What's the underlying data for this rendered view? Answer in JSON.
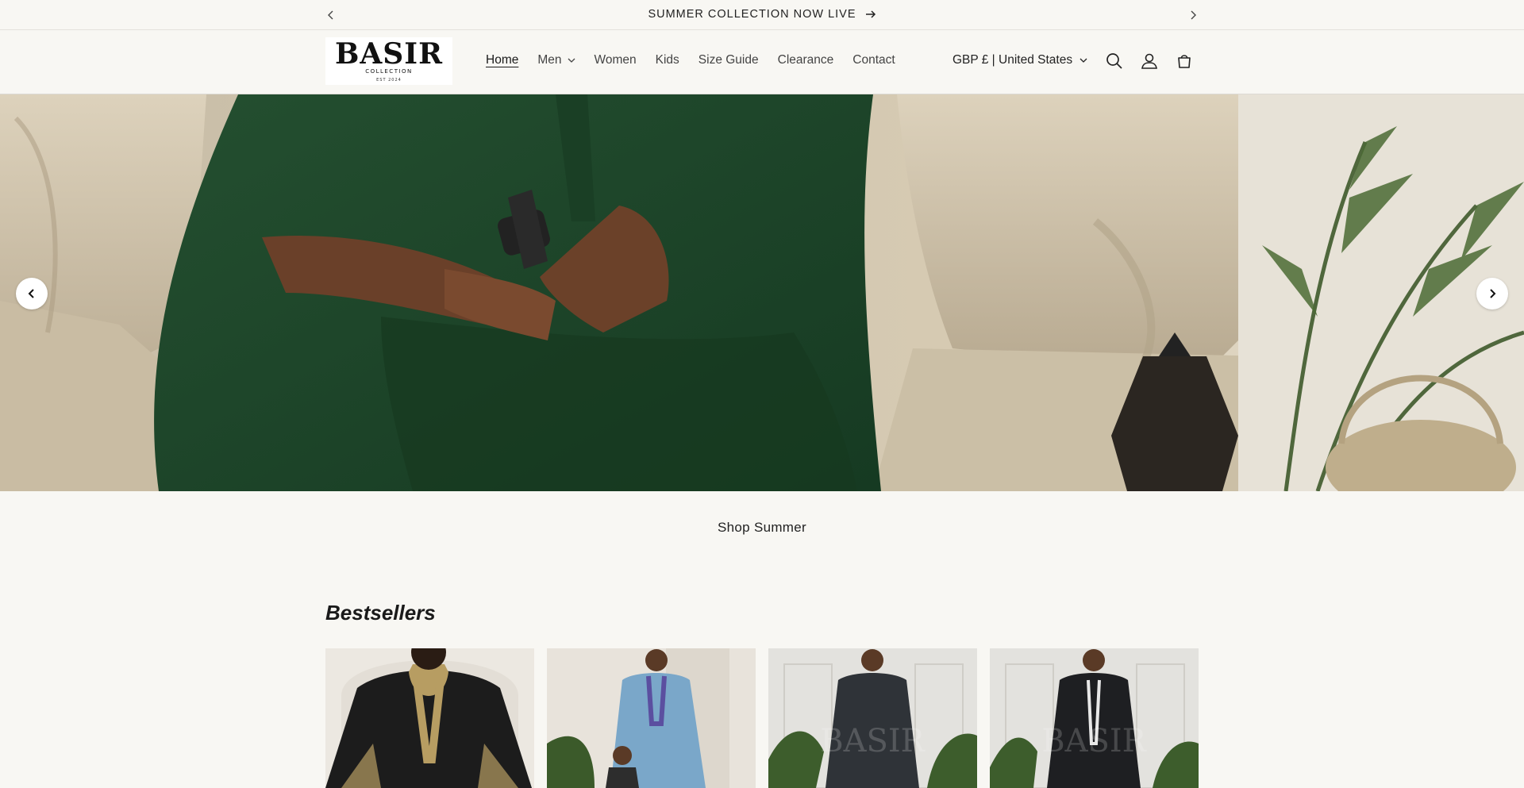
{
  "announcement": {
    "message": "SUMMER COLLECTION NOW LIVE",
    "prev_icon": "chevron-left-icon",
    "next_icon": "chevron-right-icon",
    "arrow_icon": "arrow-right-icon"
  },
  "header": {
    "logo": {
      "wordmark": "BASIR",
      "subtitle": "COLLECTION",
      "est": "EST 2024"
    },
    "nav": [
      {
        "label": "Home",
        "active": true
      },
      {
        "label": "Men",
        "dropdown": true
      },
      {
        "label": "Women"
      },
      {
        "label": "Kids"
      },
      {
        "label": "Size Guide"
      },
      {
        "label": "Clearance"
      },
      {
        "label": "Contact"
      }
    ],
    "currency": "GBP £ | United States",
    "icons": [
      "search-icon",
      "account-icon",
      "cart-icon"
    ]
  },
  "hero": {
    "prev_icon": "chevron-left-icon",
    "next_icon": "chevron-right-icon",
    "link": "Shop Summer"
  },
  "bestsellers": {
    "title": "Bestsellers",
    "watermark": "BASIR"
  },
  "colors": {
    "background": "#f8f7f3",
    "thobe_green": "#1f4a2c",
    "sofa": "#d3c7b1"
  }
}
